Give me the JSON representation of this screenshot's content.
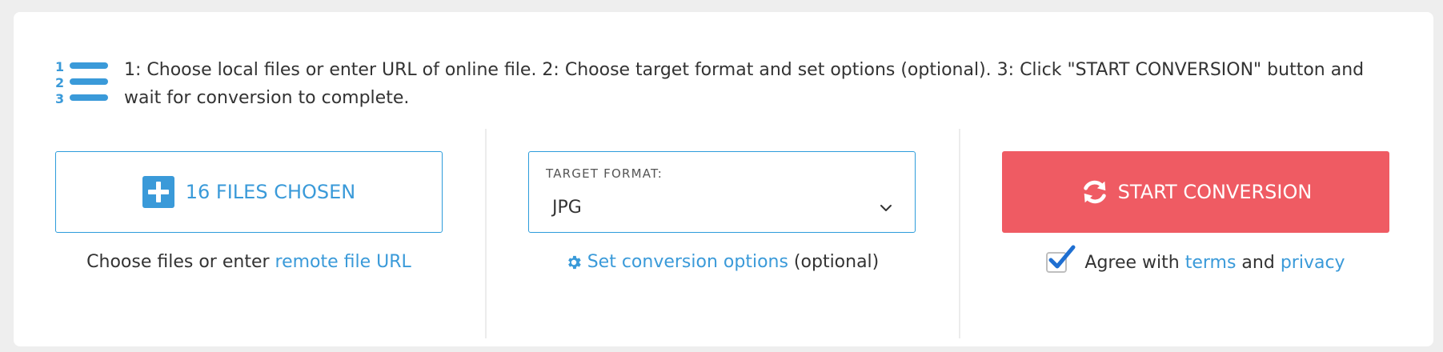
{
  "instructions": {
    "text": "1: Choose local files or enter URL of online file. 2: Choose target format and set options (optional). 3: Click \"START CONVERSION\" button and wait for conversion to complete.",
    "icon": "numbered-list-icon"
  },
  "files": {
    "button_label": "16 FILES CHOSEN",
    "icon": "plus-icon",
    "helper_prefix": "Choose files or enter ",
    "helper_link": "remote file URL"
  },
  "format": {
    "label": "TARGET FORMAT:",
    "selected": "JPG",
    "options_link": "Set conversion options",
    "options_suffix": " (optional)",
    "options_icon": "gear-icon"
  },
  "convert": {
    "button_label": "START CONVERSION",
    "icon": "refresh-icon",
    "agree_checked": true,
    "agree_prefix": "Agree with ",
    "terms_link": "terms",
    "agree_middle": " and ",
    "privacy_link": "privacy"
  },
  "colors": {
    "accent": "#3a9ad9",
    "convert_button": "#ef5b63",
    "background": "#eeeeee",
    "card": "#ffffff"
  }
}
